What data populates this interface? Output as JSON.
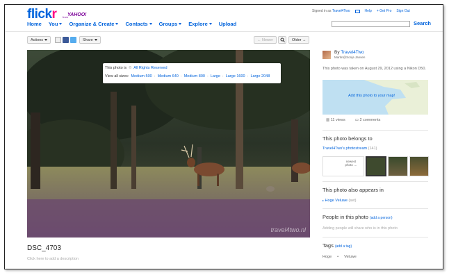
{
  "header": {
    "logo_fl": "flick",
    "logo_r": "r",
    "logo_from": "from",
    "logo_yahoo": "YAHOO!",
    "nav": [
      "Home",
      "You",
      "Organize & Create",
      "Contacts",
      "Groups",
      "Explore",
      "Upload"
    ],
    "signed_in_as": "Signed in as",
    "user": "Travel4Two",
    "help": "Help",
    "get_pro": "+ Get Pro",
    "sign_out": "Sign Out",
    "search_label": "Search",
    "search_placeholder": ""
  },
  "toolbar": {
    "actions": "Actions",
    "share": "Share",
    "newer": "← Newer",
    "older": "Older →"
  },
  "photo": {
    "overlay_prefix": "This photo is ",
    "rights": "All Rights Reserved",
    "sizes_label": "View all sizes:",
    "sizes": [
      "Medium 500",
      "Medium 640",
      "Medium 800",
      "Large",
      "Large 1600",
      "Large 2048"
    ],
    "watermark": "travel4two.nl",
    "title": "DSC_4703",
    "description_placeholder": "Click here to add a description"
  },
  "sidebar": {
    "by_prefix": "By ",
    "owner": "Travel4Two",
    "attribution": "Martin@Sonja Jansen",
    "taken": "This photo was taken on August 29, 2012 using a Nikon D50.",
    "map_link": "Add this photo to your map!",
    "views": "11 views",
    "comments": "2 comments",
    "belongs_heading": "This photo belongs to",
    "photostream": "Travel4Two's photostream",
    "photostream_count": "(141)",
    "newest_photo": "newest photo →",
    "appears_heading": "This photo also appears in",
    "set_name": "Hoge Veluwe",
    "set_suffix": "(set)",
    "people_heading": "People in this photo",
    "add_person": "(add a person)",
    "people_hint": "Adding people will share who is in this photo",
    "tags_heading": "Tags",
    "add_tag": "(add a tag)",
    "tags": [
      "Hoge",
      "Veluwe"
    ]
  }
}
